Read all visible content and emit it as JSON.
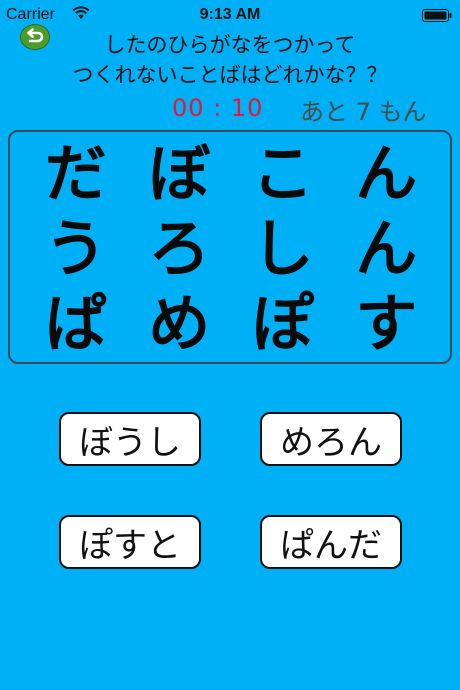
{
  "status_bar": {
    "carrier": "Carrier",
    "time": "9:13 AM"
  },
  "question": {
    "line1": "したのひらがなをつかって",
    "line2": "つくれないことばはどれかな？？"
  },
  "timer": "00 : 10",
  "remaining": "あと 7 もん",
  "kana_grid": [
    [
      "だ",
      "ぼ",
      "こ",
      "ん"
    ],
    [
      "う",
      "ろ",
      "し",
      "ん"
    ],
    [
      "ぱ",
      "め",
      "ぽ",
      "す"
    ]
  ],
  "answers": [
    "ぼうし",
    "めろん",
    "ぽすと",
    "ぱんだ"
  ],
  "colors": {
    "background": "#00b0f6",
    "timer": "#e5173a",
    "back_button": "#4b9d2b"
  },
  "icons": {
    "back": "return-arrow-icon",
    "wifi": "wifi-icon",
    "battery": "battery-icon"
  }
}
